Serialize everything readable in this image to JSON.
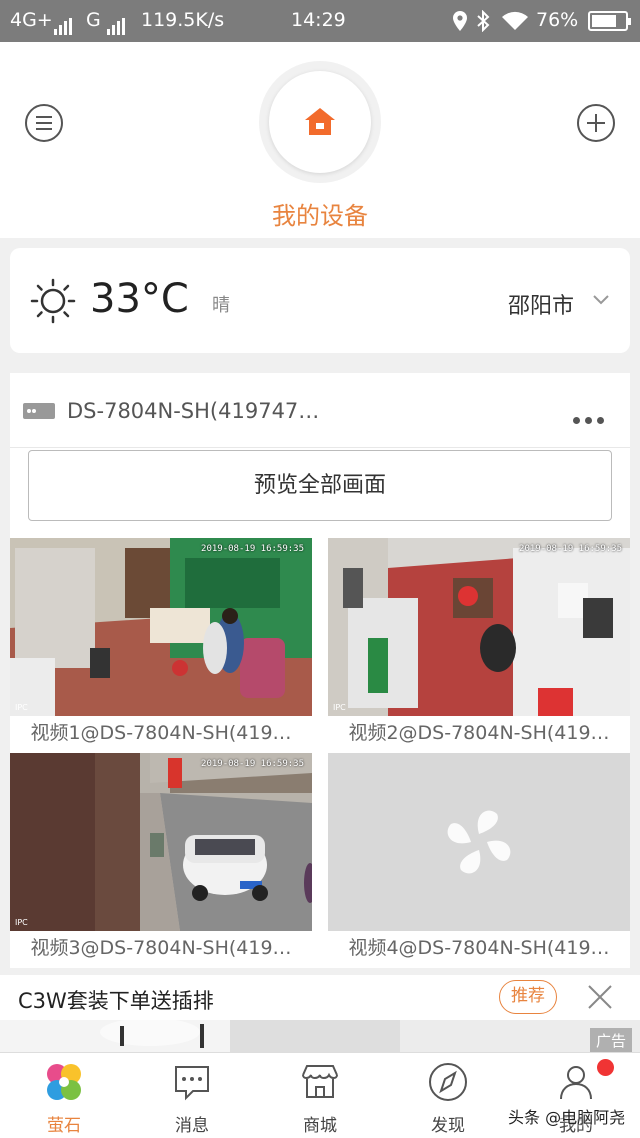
{
  "status_bar": {
    "network_left": "4G+",
    "network_mid": "G",
    "speed": "119.5K/s",
    "time": "14:29",
    "battery": "76%",
    "battery_level": 0.76,
    "icons": [
      "location-icon",
      "bluetooth-icon",
      "wifi-icon",
      "battery-icon"
    ]
  },
  "header": {
    "title": "我的设备",
    "menu_icon": "menu-icon",
    "add_icon": "add-icon",
    "home_icon": "home-icon",
    "accent": "#e8843f"
  },
  "weather": {
    "icon": "sun-icon",
    "temperature": "33°C",
    "condition": "晴",
    "city": "邵阳市"
  },
  "device": {
    "name": "DS-7804N-SH(419747…",
    "preview_all": "预览全部画面",
    "channels": [
      {
        "label": "视频1@DS-7804N-SH(419…",
        "timestamp": "2019-08-19 16:59:35",
        "tag": "IPC"
      },
      {
        "label": "视频2@DS-7804N-SH(419…",
        "timestamp": "2019-08-19 16:59:35",
        "tag": "IPC"
      },
      {
        "label": "视频3@DS-7804N-SH(419…",
        "timestamp": "2019-08-19 16:59:35",
        "tag": "IPC"
      },
      {
        "label": "视频4@DS-7804N-SH(419…",
        "timestamp": "",
        "tag": ""
      }
    ]
  },
  "ad": {
    "title": "C3W套装下单送插排",
    "tag": "推荐",
    "badge": "广告"
  },
  "tabbar": {
    "items": [
      {
        "label": "萤石",
        "icon": "ezviz-logo-icon"
      },
      {
        "label": "消息",
        "icon": "message-icon"
      },
      {
        "label": "商城",
        "icon": "store-icon"
      },
      {
        "label": "发现",
        "icon": "compass-icon"
      },
      {
        "label": "我的",
        "icon": "user-icon"
      }
    ],
    "active_color": "#e8843f"
  },
  "watermark": "头条 @电脑阿尧"
}
